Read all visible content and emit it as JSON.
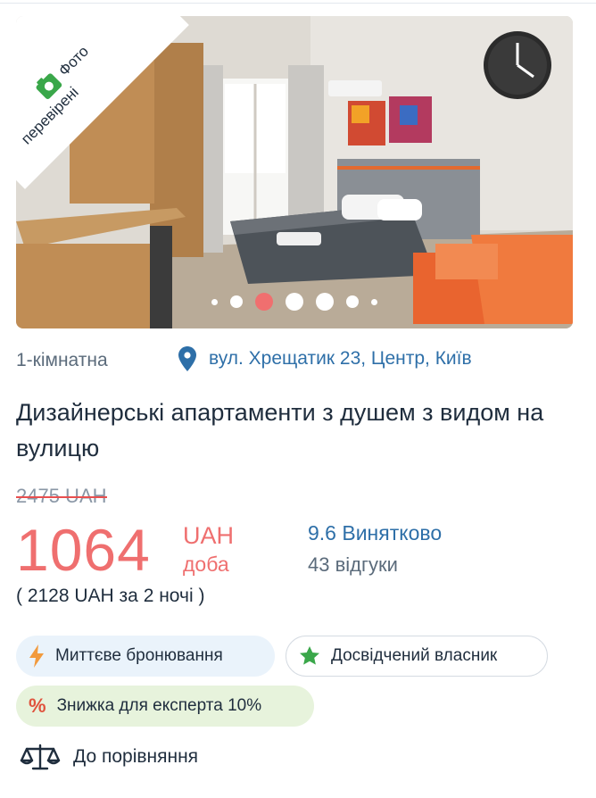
{
  "listing": {
    "photo": {
      "badge_line1": "Фото",
      "badge_line2": "перевірені",
      "active_slide": 2
    },
    "rooms": "1-кімнатна",
    "address": "вул. Хрещатик 23, Центр, Київ",
    "title": "Дизайнерські апартаменти з душем з видом на вулицю",
    "old_price": "2475 UAH",
    "price": "1064",
    "currency": "UAH",
    "per": "доба",
    "total": "( 2128 UAH за 2 ночі )",
    "rating": "9.6 Винятково",
    "reviews": "43 відгуки",
    "tags": {
      "instant": "Миттєве бронювання",
      "host": "Досвідчений власник",
      "discount": "Знижка для експерта 10%"
    },
    "compare": "До порівняння"
  },
  "colors": {
    "accent_red": "#ef6f6f",
    "link_blue": "#2e6fa8",
    "verified_green": "#3aa74a"
  }
}
